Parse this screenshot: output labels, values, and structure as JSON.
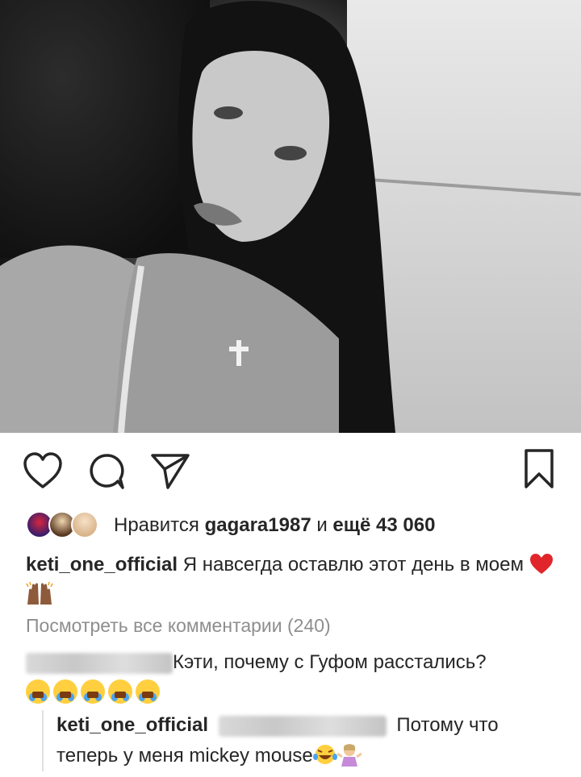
{
  "post": {
    "photo_icon": "portrait-photo"
  },
  "actions": {
    "like_icon": "heart-icon",
    "comment_icon": "comment-icon",
    "share_icon": "paper-plane-icon",
    "save_icon": "bookmark-icon"
  },
  "likes": {
    "prefix": "Нравится",
    "user": "gagara1987",
    "middle": "и",
    "count": "ещё 43 060"
  },
  "caption": {
    "username": "keti_one_official",
    "text": "Я навсегда оставлю этот день в моем",
    "emojis": [
      "red-heart",
      "raised-hands"
    ]
  },
  "comments": {
    "view_all": "Посмотреть все комментарии (240)",
    "items": [
      {
        "author_blurred": true,
        "text": "Кэти, почему с Гуфом расстались?",
        "emojis": [
          "crying-face",
          "crying-face",
          "crying-face",
          "crying-face",
          "crying-face"
        ]
      }
    ],
    "reply": {
      "username": "keti_one_official",
      "mention_blurred": true,
      "text_line1": "Потому что",
      "text_line2": "теперь у меня mickey mouse"
    }
  }
}
